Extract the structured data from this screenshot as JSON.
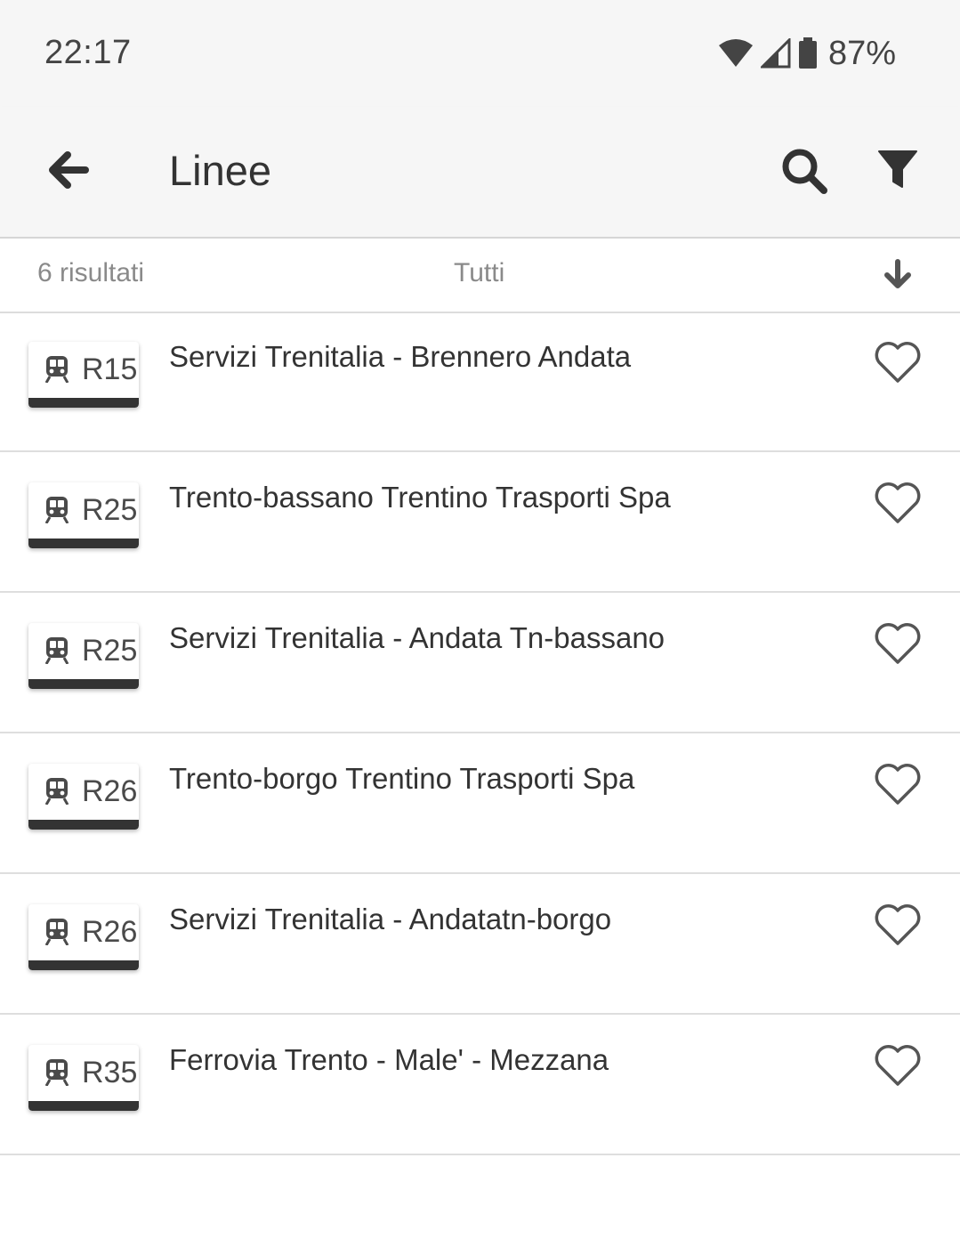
{
  "status_bar": {
    "time": "22:17",
    "battery": "87%",
    "icons": [
      "wifi-icon",
      "signal-icon",
      "battery-icon"
    ]
  },
  "app_bar": {
    "title": "Linee",
    "icons": [
      "back-arrow-icon",
      "search-icon",
      "filter-icon"
    ]
  },
  "filter_bar": {
    "results": "6 risultati",
    "filter": "Tutti",
    "sort_icon": "arrow-down-icon"
  },
  "lines": [
    {
      "code": "R15",
      "title": "Servizi Trenitalia - Brennero Andata",
      "icon": "train-icon"
    },
    {
      "code": "R25",
      "title": "Trento-bassano Trentino Trasporti Spa",
      "icon": "train-icon"
    },
    {
      "code": "R25",
      "title": "Servizi Trenitalia - Andata Tn-bassano",
      "icon": "train-icon"
    },
    {
      "code": "R26",
      "title": "Trento-borgo Trentino Trasporti Spa",
      "icon": "train-icon"
    },
    {
      "code": "R26",
      "title": "Servizi Trenitalia - Andatatn-borgo",
      "icon": "train-icon"
    },
    {
      "code": "R35",
      "title": "Ferrovia Trento - Male' - Mezzana",
      "icon": "train-icon"
    }
  ],
  "colors": {
    "appbar_bg": "#f6f6f6",
    "badge_bar": "#333333",
    "text_muted": "#8a8a8a",
    "icon_dark": "#333333"
  }
}
